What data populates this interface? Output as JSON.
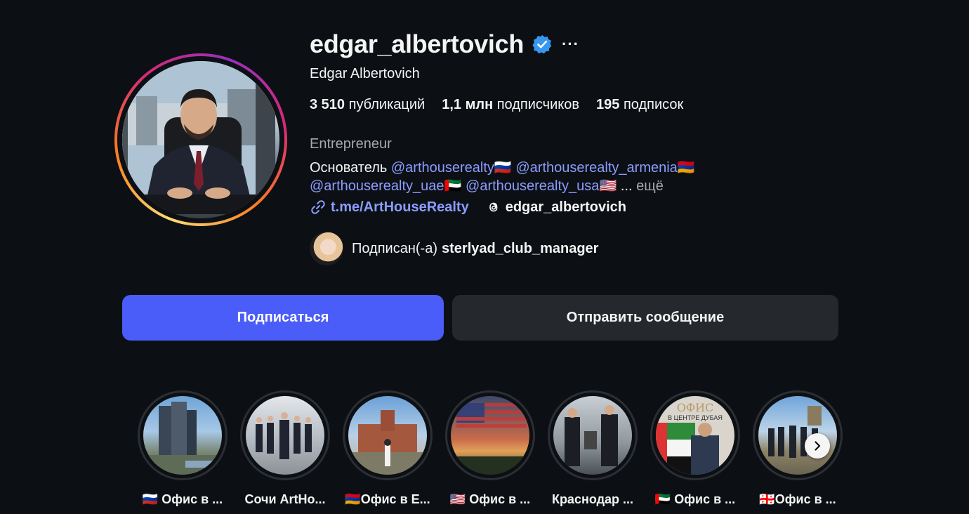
{
  "profile": {
    "username": "edgar_albertovich",
    "more_icon": "···",
    "full_name": "Edgar Albertovich",
    "stats": {
      "posts_count": "3 510",
      "posts_label": "публикаций",
      "followers_count": "1,1 млн",
      "followers_label": "подписчиков",
      "following_count": "195",
      "following_label": "подписок"
    },
    "category": "Entrepreneur",
    "bio": {
      "prefix": "Основатель",
      "mention1": "@arthouserealty",
      "flag1": "🇷🇺",
      "mention2": "@arthouserealty_armenia",
      "flag2": "🇦🇲",
      "mention3": "@arthouserealty_uae",
      "flag3": "🇦🇪",
      "mention4": "@arthouserealty_usa",
      "flag4": "🇺🇸",
      "ellipsis": "...",
      "more": "ещё"
    },
    "link_text": "t.me/ArtHouseRealty",
    "threads_handle": "edgar_albertovich",
    "followed_by": {
      "prefix": "Подписан(-а)",
      "username": "sterlyad_club_manager"
    }
  },
  "actions": {
    "follow_label": "Подписаться",
    "message_label": "Отправить сообщение"
  },
  "highlights": [
    {
      "label": "🇷🇺 Офис в ..."
    },
    {
      "label": "Сочи ArtHo..."
    },
    {
      "label": "🇦🇲Офис в Е..."
    },
    {
      "label": "🇺🇸 Офис в ..."
    },
    {
      "label": "Краснодар ..."
    },
    {
      "label": "🇦🇪 Офис в ..."
    },
    {
      "label": "🇬🇪Офис в ..."
    }
  ],
  "highlight_overlay_texts": {
    "office_title": "ОФИС",
    "office_subtitle": "В ЦЕНТРЕ ДУБАЯ"
  },
  "colors": {
    "background": "#0c1014",
    "accent": "#4a5df9",
    "mention": "#8c9cff",
    "verified": "#3897f0"
  },
  "icons": {
    "verified": "verified-badge-icon",
    "link": "link-icon",
    "threads": "threads-icon",
    "next": "chevron-right-icon"
  }
}
